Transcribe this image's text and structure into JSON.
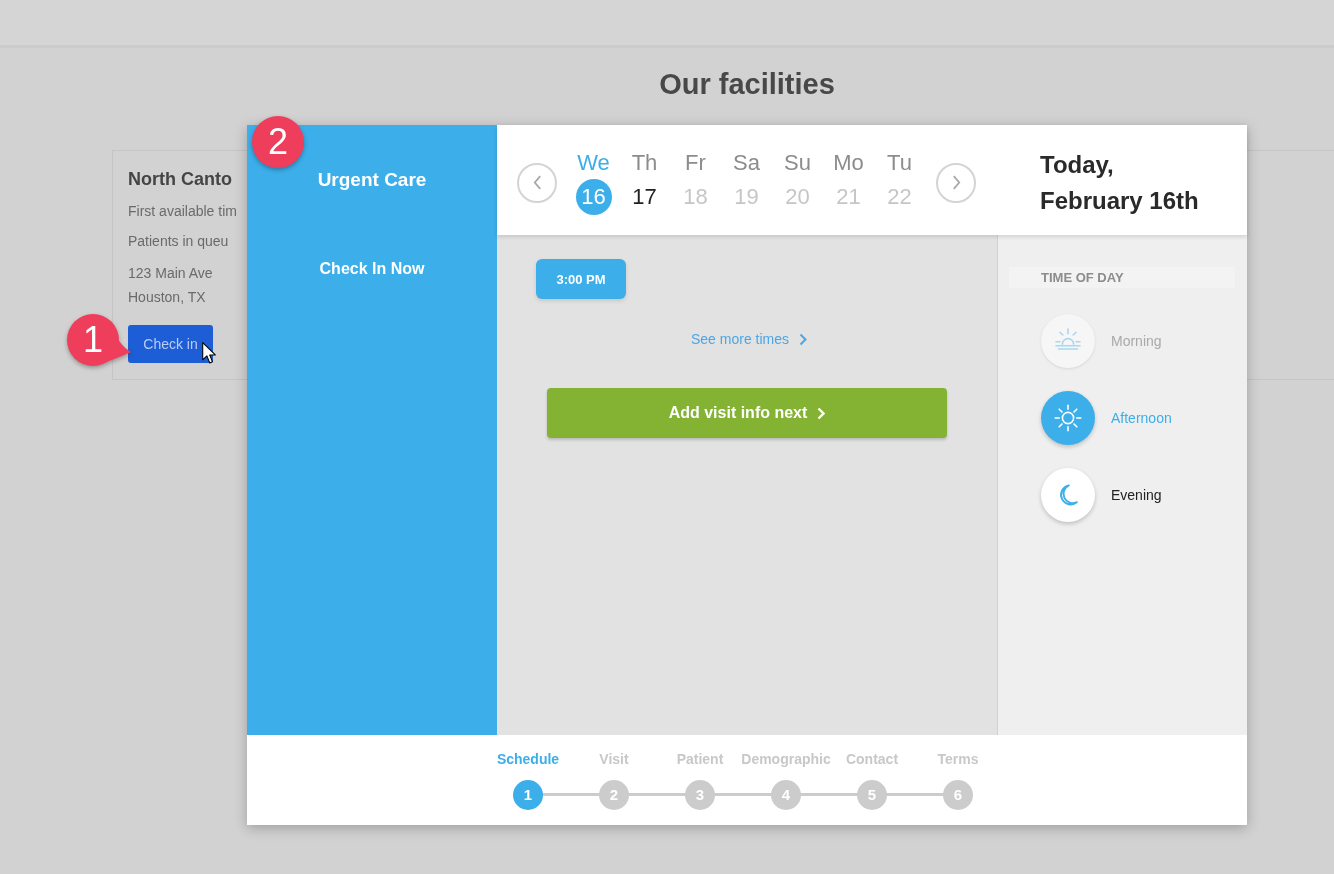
{
  "page": {
    "heading": "Our facilities"
  },
  "facility_card": {
    "name": "North Canto",
    "details": [
      "First available tim",
      "Patients in queu"
    ],
    "address": [
      "123 Main Ave",
      "Houston, TX"
    ],
    "button": "Check in"
  },
  "annotations": [
    {
      "label": "1",
      "pointer": true
    },
    {
      "label": "2",
      "pointer": false
    }
  ],
  "sidebar": {
    "title": "Urgent Care",
    "items": [
      {
        "label": "Check In Now"
      }
    ]
  },
  "calendar": {
    "days": [
      {
        "weekday": "We",
        "date": "16",
        "selected": true,
        "disabled": false
      },
      {
        "weekday": "Th",
        "date": "17",
        "selected": false,
        "disabled": false
      },
      {
        "weekday": "Fr",
        "date": "18",
        "selected": false,
        "disabled": true
      },
      {
        "weekday": "Sa",
        "date": "19",
        "selected": false,
        "disabled": true
      },
      {
        "weekday": "Su",
        "date": "20",
        "selected": false,
        "disabled": true
      },
      {
        "weekday": "Mo",
        "date": "21",
        "selected": false,
        "disabled": true
      },
      {
        "weekday": "Tu",
        "date": "22",
        "selected": false,
        "disabled": true
      }
    ],
    "heading": "Today, February 16th"
  },
  "time_slots": [
    {
      "label": "3:00 PM",
      "selected": true
    }
  ],
  "more_times_link": "See more times",
  "next_button": "Add visit info next",
  "time_of_day": {
    "title": "TIME OF DAY",
    "options": [
      {
        "label": "Morning",
        "kind": "morning",
        "selected": false,
        "disabled": true
      },
      {
        "label": "Afternoon",
        "kind": "afternoon",
        "selected": true,
        "disabled": false
      },
      {
        "label": "Evening",
        "kind": "evening",
        "selected": false,
        "disabled": false
      }
    ]
  },
  "stepper": [
    {
      "label": "Schedule",
      "number": "1",
      "selected": true
    },
    {
      "label": "Visit",
      "number": "2",
      "selected": false
    },
    {
      "label": "Patient",
      "number": "3",
      "selected": false
    },
    {
      "label": "Demographic",
      "number": "4",
      "selected": false
    },
    {
      "label": "Contact",
      "number": "5",
      "selected": false
    },
    {
      "label": "Terms",
      "number": "6",
      "selected": false
    }
  ]
}
